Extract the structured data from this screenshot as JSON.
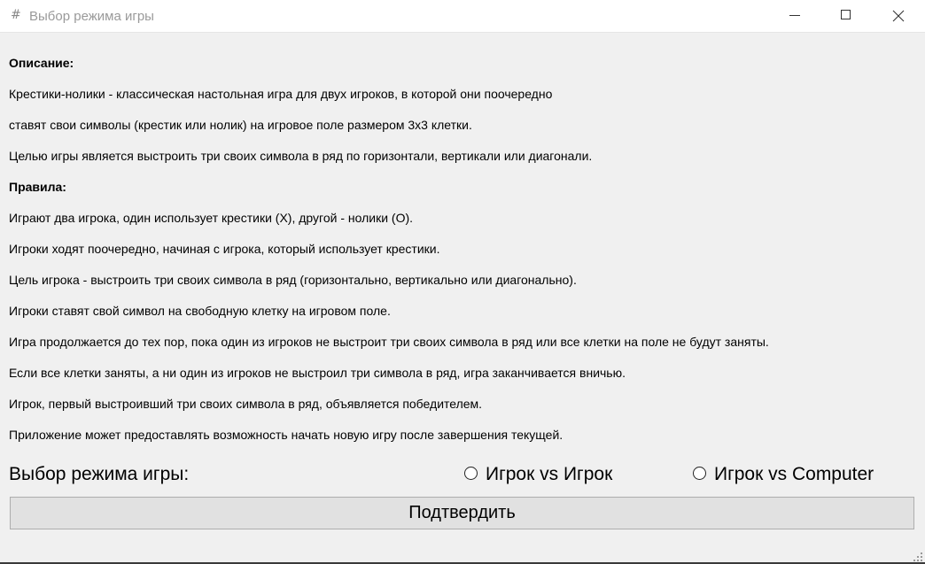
{
  "window": {
    "icon": "hash-icon",
    "title": "Выбор режима игры"
  },
  "description": {
    "heading": "Описание:",
    "lines": [
      "Крестики-нолики - классическая настольная игра для двух игроков, в которой они поочередно",
      "ставят свои символы (крестик или нолик) на игровое поле размером 3x3 клетки.",
      "Целью игры является выстроить три своих символа в ряд по горизонтали, вертикали или диагонали."
    ]
  },
  "rules": {
    "heading": "Правила:",
    "lines": [
      "Играют два игрока, один использует крестики (X), другой - нолики (O).",
      "Игроки ходят поочередно, начиная с игрока, который использует крестики.",
      "Цель игрока - выстроить три своих символа в ряд (горизонтально, вертикально или диагонально).",
      "Игроки ставят свой символ на свободную клетку на игровом поле.",
      "Игра продолжается до тех пор, пока один из игроков не выстроит три своих символа в ряд или все клетки на поле не будут заняты.",
      "Если все клетки заняты, а ни один из игроков не выстроил три символа в ряд, игра заканчивается вничью.",
      "Игрок, первый выстроивший три своих символа в ряд, объявляется победителем.",
      "Приложение может предоставлять возможность начать новую игру после завершения текущей."
    ]
  },
  "mode": {
    "label": "Выбор режима игры:",
    "options": [
      {
        "label": "Игрок vs Игрок",
        "selected": false
      },
      {
        "label": "Игрок vs Computer",
        "selected": false
      }
    ]
  },
  "confirm_label": "Подтвердить"
}
